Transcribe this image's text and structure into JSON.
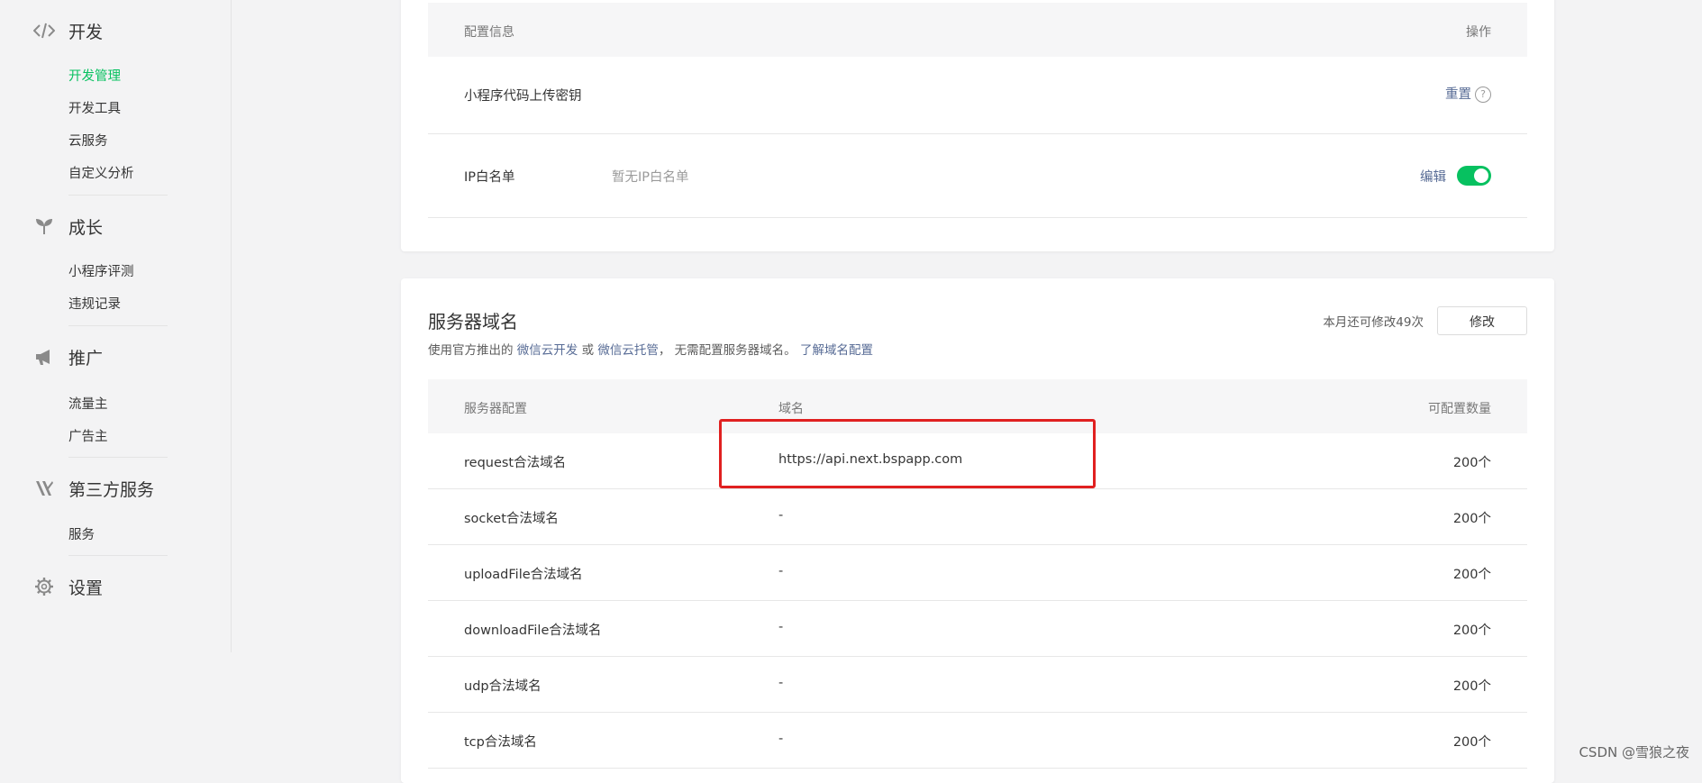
{
  "sidebar": {
    "groups": [
      {
        "title": "开发",
        "icon": "code-icon",
        "items": [
          "开发管理",
          "开发工具",
          "云服务",
          "自定义分析"
        ]
      },
      {
        "title": "成长",
        "icon": "sprout-icon",
        "items": [
          "小程序评测",
          "违规记录"
        ]
      },
      {
        "title": "推广",
        "icon": "megaphone-icon",
        "items": [
          "流量主",
          "广告主"
        ]
      },
      {
        "title": "第三方服务",
        "icon": "third-party-icon",
        "items": [
          "服务"
        ]
      },
      {
        "title": "设置",
        "icon": "gear-icon",
        "items": []
      }
    ],
    "active_item": "开发管理"
  },
  "config_card": {
    "header": {
      "col1": "配置信息",
      "col2": "操作"
    },
    "rows": [
      {
        "label": "小程序代码上传密钥",
        "value": "",
        "action": "重置"
      },
      {
        "label": "IP白名单",
        "value": "暂无IP白名单",
        "action": "编辑",
        "toggle_on": true
      }
    ]
  },
  "domain_card": {
    "title": "服务器域名",
    "desc": {
      "prefix": "使用官方推出的",
      "link1": "微信云开发",
      "or": "或",
      "link2": "微信云托管",
      "suffix": "， 无需配置服务器域名。",
      "link3": "了解域名配置"
    },
    "quota_text": "本月还可修改49次",
    "modify_label": "修改",
    "header": {
      "col1": "服务器配置",
      "col2": "域名",
      "col3": "可配置数量"
    },
    "rows": [
      {
        "type": "request合法域名",
        "domain": "https://api.next.bspapp.com",
        "count": "200个"
      },
      {
        "type": "socket合法域名",
        "domain": "-",
        "count": "200个"
      },
      {
        "type": "uploadFile合法域名",
        "domain": "-",
        "count": "200个"
      },
      {
        "type": "downloadFile合法域名",
        "domain": "-",
        "count": "200个"
      },
      {
        "type": "udp合法域名",
        "domain": "-",
        "count": "200个"
      },
      {
        "type": "tcp合法域名",
        "domain": "-",
        "count": "200个"
      }
    ]
  },
  "colors": {
    "accent": "#07c160",
    "link": "#576b95",
    "highlight": "#e02020"
  },
  "watermark": "CSDN @雪狼之夜"
}
